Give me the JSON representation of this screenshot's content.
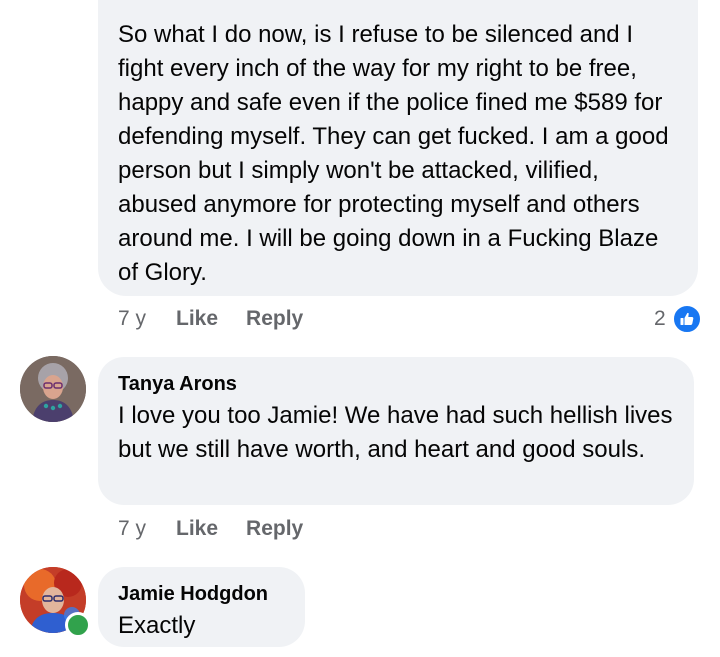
{
  "comments": [
    {
      "author": "",
      "text": "So what I do now, is I refuse to be silenced and I fight every inch of the way for my right to be free, happy and safe even if the police fined me $589 for defending myself.  They can get fucked.  I am a good person but I simply won't be attacked, vilified, abused anymore for protecting myself and others around me.  I will be going down in a Fucking Blaze of Glory.",
      "time": "7 y",
      "like_label": "Like",
      "reply_label": "Reply",
      "reaction_count": "2",
      "reaction_icon": "thumbs-up-icon"
    },
    {
      "author": "Tanya Arons",
      "text": "I love you too Jamie!  We have had such hellish lives but we still have worth, and heart and good souls.",
      "time": "7 y",
      "like_label": "Like",
      "reply_label": "Reply"
    },
    {
      "author": "Jamie Hodgdon",
      "text": "Exactly",
      "online": true
    }
  ],
  "colors": {
    "bubble": "#f0f2f5",
    "meta_text": "#65676b",
    "like_badge": "#1877f2",
    "online": "#31a24c"
  }
}
